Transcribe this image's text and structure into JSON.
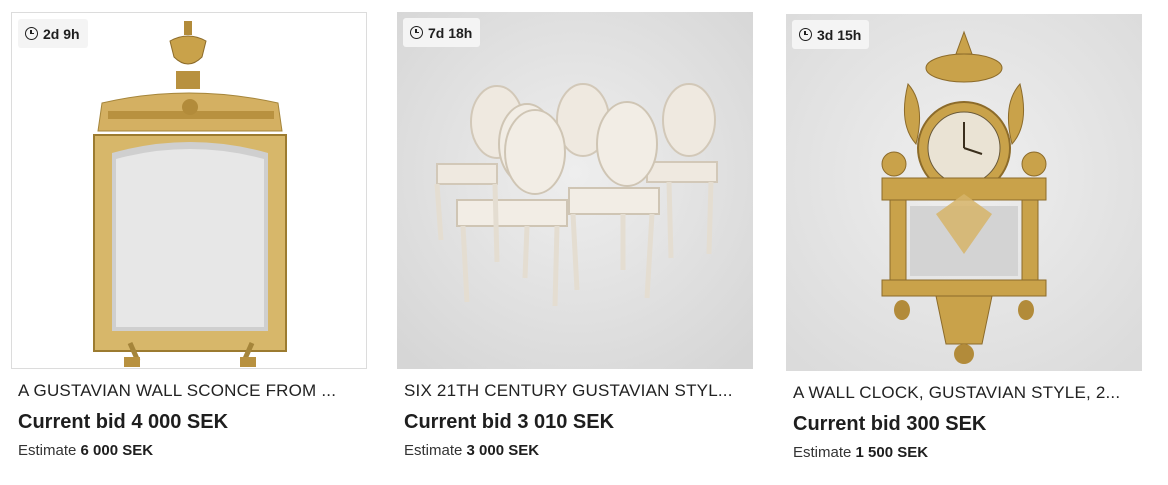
{
  "items": [
    {
      "time_left": "2d 9h",
      "title": "A GUSTAVIAN WALL SCONCE FROM ...",
      "current_bid": "Current bid 4 000 SEK",
      "estimate_label": "Estimate",
      "estimate_value": "6 000 SEK",
      "image": "gilt-mirror-sconce"
    },
    {
      "time_left": "7d 18h",
      "title": "SIX 21TH CENTURY GUSTAVIAN STYL...",
      "current_bid": "Current bid 3 010 SEK",
      "estimate_label": "Estimate",
      "estimate_value": "3 000 SEK",
      "image": "six-white-chairs"
    },
    {
      "time_left": "3d 15h",
      "title": "A WALL CLOCK, GUSTAVIAN STYLE, 2...",
      "current_bid": "Current bid 300 SEK",
      "estimate_label": "Estimate",
      "estimate_value": "1 500 SEK",
      "image": "gilt-wall-clock"
    }
  ],
  "icons": {
    "timer": "clock-icon"
  },
  "colors": {
    "gold": "#c9a24a",
    "gold_dark": "#9c7b30",
    "chair_white": "#efe9e0",
    "panel_grey": "#e3e3e3"
  }
}
